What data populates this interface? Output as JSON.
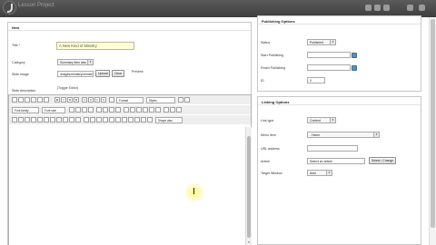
{
  "app": {
    "title": "Lesson Project"
  },
  "left_panel": {
    "heading": "New",
    "title_label": "Title *",
    "title_value": "A New Kind of Ministry",
    "category_label": "Category",
    "category_value": "Summary Item also",
    "slide_image_label": "Slide image",
    "slide_image_value": "images/ministry/ministry",
    "upload_button": "Upload",
    "clear_button": "Clear",
    "preview_label": "Preview",
    "slide_description_label": "Slide description",
    "toggle_editor": "[Toggle Editor]"
  },
  "editor_toolbar": {
    "row1": [
      "B",
      "I",
      "U",
      "S",
      "≡",
      "≡",
      "≡",
      "≡"
    ],
    "format_select": "Format",
    "styles_select": "Styles",
    "font_family_select": "Font family",
    "font_size_select": "Font size",
    "row3_select": "Shape also"
  },
  "publishing": {
    "heading": "Publishing Options",
    "status_label": "Status",
    "status_value": "Published",
    "start_label": "Start Publishing",
    "finish_label": "Finish Publishing",
    "id_label": "ID",
    "id_value": "0"
  },
  "linking": {
    "heading": "Linking Options",
    "link_type_label": "Link type",
    "link_type_value": "Content",
    "menu_item_label": "Menu item",
    "menu_item_value": "- Home",
    "url_label": "URL address",
    "article_label": "Article",
    "article_value": "Select an article",
    "select_change_button": "Select / Change",
    "target_label": "Target Window",
    "target_value": "Auto"
  }
}
